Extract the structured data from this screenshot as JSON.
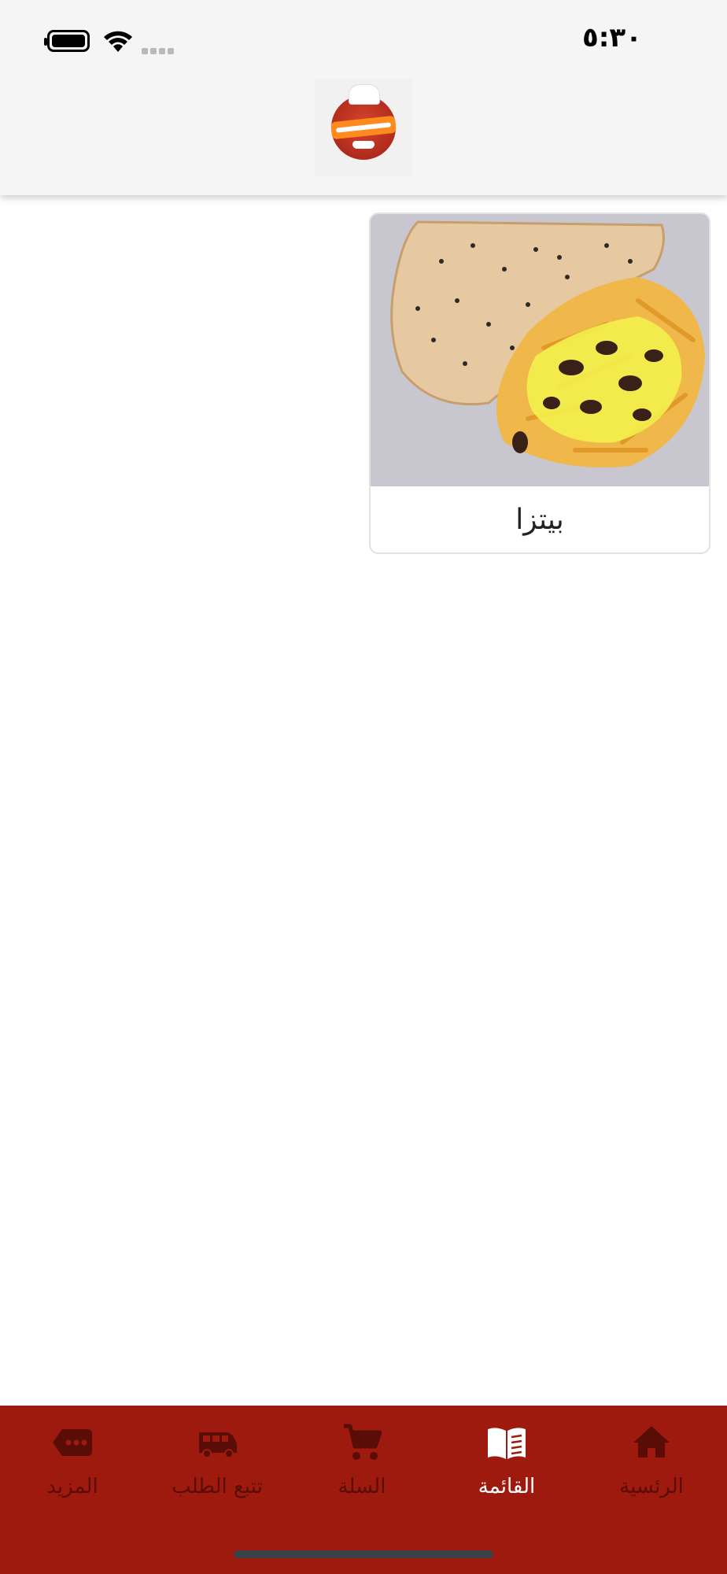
{
  "status_bar": {
    "time": "٥:٣٠"
  },
  "header": {
    "logo_icon": "kwarshy-logo"
  },
  "categories": [
    {
      "label": "بيتزا",
      "image": "pizza-and-fries-photo"
    }
  ],
  "bottom_nav": {
    "items": [
      {
        "label": "الرئسية",
        "icon": "home-icon"
      },
      {
        "label": "القائمة",
        "icon": "menu-book-icon",
        "active": true
      },
      {
        "label": "السلة",
        "icon": "cart-icon"
      },
      {
        "label": "تتبع الطلب",
        "icon": "delivery-van-icon"
      },
      {
        "label": "المزيد",
        "icon": "more-tag-icon"
      }
    ]
  },
  "colors": {
    "nav_background": "#9e1a0f",
    "nav_inactive": "#5a0d07",
    "nav_active": "#ffffff",
    "header_background": "#f5f5f5"
  }
}
